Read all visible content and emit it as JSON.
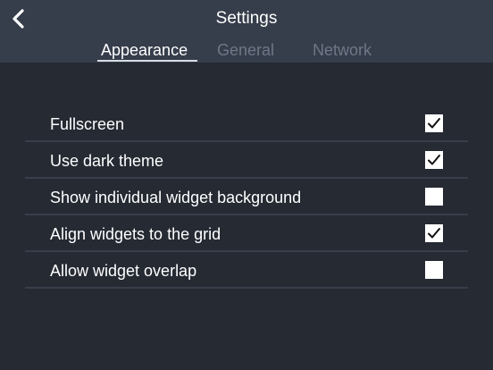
{
  "header": {
    "title": "Settings",
    "back_icon": "chevron-left-icon"
  },
  "tabs": [
    {
      "label": "Appearance",
      "active": true
    },
    {
      "label": "General",
      "active": false
    },
    {
      "label": "Network",
      "active": false
    }
  ],
  "settings": [
    {
      "label": "Fullscreen",
      "checked": true
    },
    {
      "label": "Use dark theme",
      "checked": true
    },
    {
      "label": "Show individual widget background",
      "checked": false
    },
    {
      "label": "Align widgets to the grid",
      "checked": true
    },
    {
      "label": "Allow widget overlap",
      "checked": false
    }
  ],
  "colors": {
    "background": "#252a33",
    "header": "#363d4b",
    "inactive_tab": "#6f7787",
    "divider": "#383e4b"
  }
}
